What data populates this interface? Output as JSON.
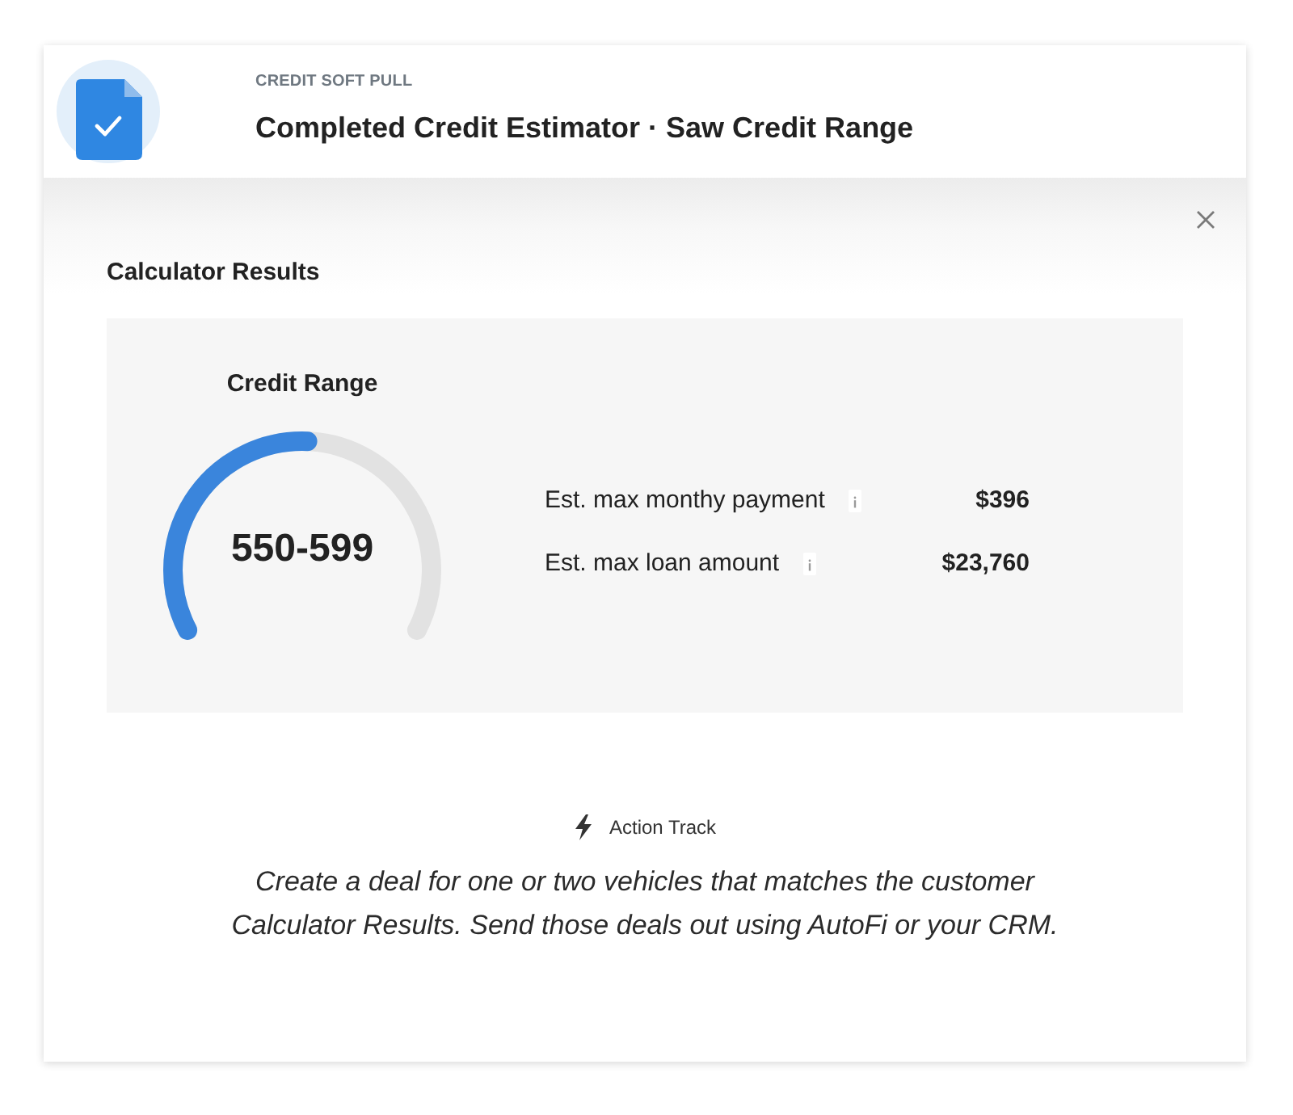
{
  "header": {
    "eyebrow": "CREDIT SOFT PULL",
    "title": "Completed Credit Estimator · Saw Credit Range"
  },
  "section_title": "Calculator Results",
  "credit_range": {
    "label": "Credit Range",
    "value": "550-599",
    "level": 0.51
  },
  "estimates": [
    {
      "label": "Est. max monthy payment",
      "value": "$396"
    },
    {
      "label": "Est. max loan amount",
      "value": "$23,760"
    }
  ],
  "action_track": {
    "label": "Action Track",
    "text": "Create a deal for one or two vehicles that matches the customer Calculator Results. Send those deals out using AutoFi or your CRM."
  }
}
